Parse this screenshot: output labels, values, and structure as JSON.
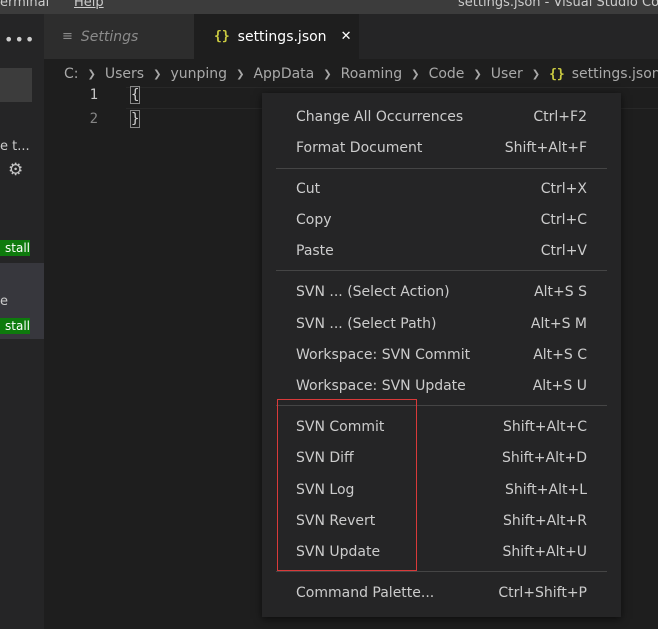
{
  "menubar": {
    "items": [
      "erminal",
      "Help"
    ],
    "window_title": "settings.json - Visual Studio Co"
  },
  "sidebar": {
    "more_label": "•••",
    "fragment_1": "e t...",
    "install_label": "stall",
    "fragment_2": "e"
  },
  "tabs": [
    {
      "label": "Settings",
      "icon": "list-icon"
    },
    {
      "label": "settings.json",
      "icon": "json-braces-icon",
      "close": "✕"
    }
  ],
  "breadcrumb": {
    "segments": [
      "C:",
      "Users",
      "yunping",
      "AppData",
      "Roaming",
      "Code",
      "User"
    ],
    "file": "settings.json",
    "file_icon": "{}"
  },
  "editor": {
    "lines": [
      {
        "number": "1",
        "text": "{"
      },
      {
        "number": "2",
        "text": "}"
      }
    ]
  },
  "context_menu": {
    "groups": [
      [
        {
          "label": "Change All Occurrences",
          "shortcut": "Ctrl+F2"
        },
        {
          "label": "Format Document",
          "shortcut": "Shift+Alt+F"
        }
      ],
      [
        {
          "label": "Cut",
          "shortcut": "Ctrl+X"
        },
        {
          "label": "Copy",
          "shortcut": "Ctrl+C"
        },
        {
          "label": "Paste",
          "shortcut": "Ctrl+V"
        }
      ],
      [
        {
          "label": "SVN ... (Select Action)",
          "shortcut": "Alt+S S"
        },
        {
          "label": "SVN ... (Select Path)",
          "shortcut": "Alt+S M"
        },
        {
          "label": "Workspace: SVN Commit",
          "shortcut": "Alt+S C"
        },
        {
          "label": "Workspace: SVN Update",
          "shortcut": "Alt+S U"
        }
      ],
      [
        {
          "label": "SVN Commit",
          "shortcut": "Shift+Alt+C"
        },
        {
          "label": "SVN Diff",
          "shortcut": "Shift+Alt+D"
        },
        {
          "label": "SVN Log",
          "shortcut": "Shift+Alt+L"
        },
        {
          "label": "SVN Revert",
          "shortcut": "Shift+Alt+R"
        },
        {
          "label": "SVN Update",
          "shortcut": "Shift+Alt+U"
        }
      ],
      [
        {
          "label": "Command Palette...",
          "shortcut": "Ctrl+Shift+P"
        }
      ]
    ]
  },
  "colors": {
    "background": "#1e1e1e",
    "sidebar": "#252526",
    "install_badge": "#0e7a0d",
    "json_icon": "#cbcb41",
    "annotation_box": "#d93a3a"
  }
}
